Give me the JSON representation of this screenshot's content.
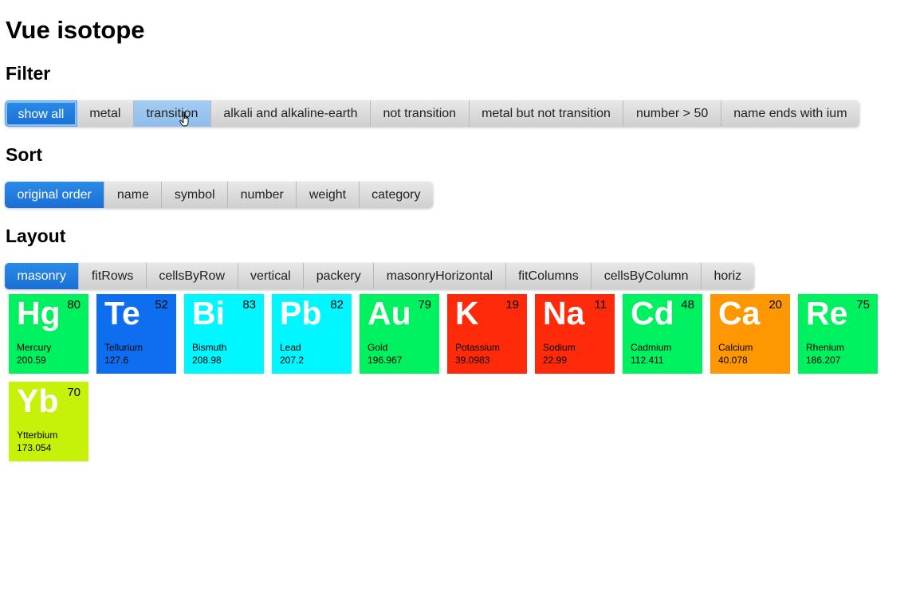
{
  "title": "Vue isotope",
  "filter": {
    "heading": "Filter",
    "buttons": [
      "show all",
      "metal",
      "transition",
      "alkali and alkaline-earth",
      "not transition",
      "metal but not transition",
      "number > 50",
      "name ends with ium"
    ]
  },
  "sort": {
    "heading": "Sort",
    "buttons": [
      "original order",
      "name",
      "symbol",
      "number",
      "weight",
      "category"
    ]
  },
  "layout": {
    "heading": "Layout",
    "buttons": [
      "masonry",
      "fitRows",
      "cellsByRow",
      "vertical",
      "packery",
      "masonryHorizontal",
      "fitColumns",
      "cellsByColumn",
      "horiz"
    ]
  },
  "elements": [
    {
      "symbol": "Hg",
      "number": "80",
      "name": "Mercury",
      "weight": "200.59",
      "color": "#00f160"
    },
    {
      "symbol": "Te",
      "number": "52",
      "name": "Tellurium",
      "weight": "127.6",
      "color": "#0d6ff0"
    },
    {
      "symbol": "Bi",
      "number": "83",
      "name": "Bismuth",
      "weight": "208.98",
      "color": "#00f7ff"
    },
    {
      "symbol": "Pb",
      "number": "82",
      "name": "Lead",
      "weight": "207.2",
      "color": "#00f7ff"
    },
    {
      "symbol": "Au",
      "number": "79",
      "name": "Gold",
      "weight": "196.967",
      "color": "#00f160"
    },
    {
      "symbol": "K",
      "number": "19",
      "name": "Potassium",
      "weight": "39.0983",
      "color": "#ff2a0a"
    },
    {
      "symbol": "Na",
      "number": "11",
      "name": "Sodium",
      "weight": "22.99",
      "color": "#ff2a0a"
    },
    {
      "symbol": "Cd",
      "number": "48",
      "name": "Cadmium",
      "weight": "112.411",
      "color": "#00f160"
    },
    {
      "symbol": "Ca",
      "number": "20",
      "name": "Calcium",
      "weight": "40.078",
      "color": "#ff9800"
    },
    {
      "symbol": "Re",
      "number": "75",
      "name": "Rhenium",
      "weight": "186.207",
      "color": "#00f160"
    },
    {
      "symbol": "Yb",
      "number": "70",
      "name": "Ytterbium",
      "weight": "173.054",
      "color": "#c6f20a"
    }
  ]
}
